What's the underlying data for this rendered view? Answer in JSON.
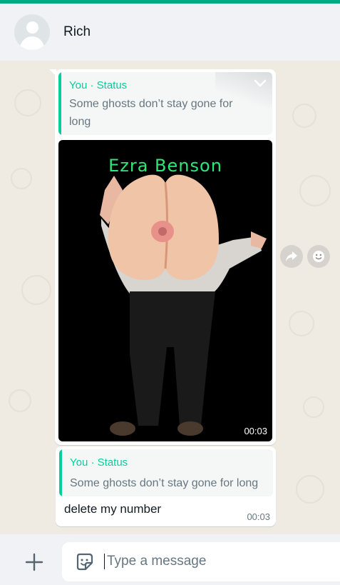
{
  "header": {
    "contact_name": "Rich"
  },
  "messages": {
    "media_message": {
      "quote_author": "You · Status",
      "quote_text": "Some ghosts don’t stay gone for long",
      "overlay_caption": "Ezra Benson",
      "time": "00:03"
    },
    "text_message": {
      "quote_author": "You · Status",
      "quote_text": "Some ghosts don’t stay gone for long",
      "body": "delete my number",
      "time": "00:03"
    }
  },
  "composer": {
    "placeholder": "Type a message"
  },
  "colors": {
    "accent": "#00a884",
    "quote_bar": "#06cf9c",
    "chat_bg": "#efeae2"
  }
}
